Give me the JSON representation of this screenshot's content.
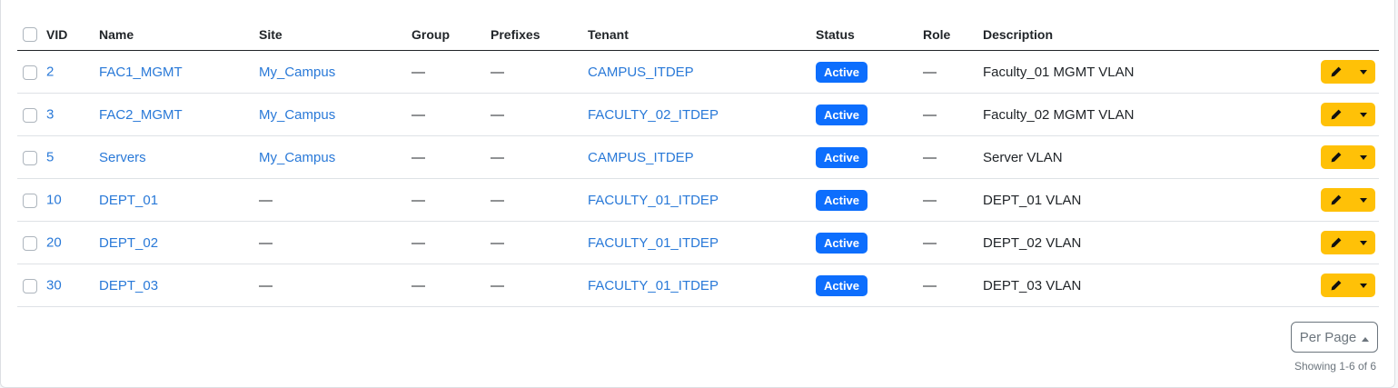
{
  "table": {
    "columns": {
      "vid": "VID",
      "name": "Name",
      "site": "Site",
      "group": "Group",
      "prefixes": "Prefixes",
      "tenant": "Tenant",
      "status": "Status",
      "role": "Role",
      "description": "Description"
    },
    "rows": [
      {
        "vid": "2",
        "name": "FAC1_MGMT",
        "site": "My_Campus",
        "group": "—",
        "prefixes": "—",
        "tenant": "CAMPUS_ITDEP",
        "status": "Active",
        "role": "—",
        "description": "Faculty_01 MGMT VLAN"
      },
      {
        "vid": "3",
        "name": "FAC2_MGMT",
        "site": "My_Campus",
        "group": "—",
        "prefixes": "—",
        "tenant": "FACULTY_02_ITDEP",
        "status": "Active",
        "role": "—",
        "description": "Faculty_02 MGMT VLAN"
      },
      {
        "vid": "5",
        "name": "Servers",
        "site": "My_Campus",
        "group": "—",
        "prefixes": "—",
        "tenant": "CAMPUS_ITDEP",
        "status": "Active",
        "role": "—",
        "description": "Server VLAN"
      },
      {
        "vid": "10",
        "name": "DEPT_01",
        "site": "—",
        "group": "—",
        "prefixes": "—",
        "tenant": "FACULTY_01_ITDEP",
        "status": "Active",
        "role": "—",
        "description": "DEPT_01 VLAN"
      },
      {
        "vid": "20",
        "name": "DEPT_02",
        "site": "—",
        "group": "—",
        "prefixes": "—",
        "tenant": "FACULTY_01_ITDEP",
        "status": "Active",
        "role": "—",
        "description": "DEPT_02 VLAN"
      },
      {
        "vid": "30",
        "name": "DEPT_03",
        "site": "—",
        "group": "—",
        "prefixes": "—",
        "tenant": "FACULTY_01_ITDEP",
        "status": "Active",
        "role": "—",
        "description": "DEPT_03 VLAN"
      }
    ]
  },
  "pagination": {
    "per_page_label": "Per Page",
    "showing": "Showing 1-6 of 6"
  },
  "colors": {
    "link": "#2979d8",
    "status_active": "#0d6efd",
    "edit_button": "#ffc107"
  },
  "icons": {
    "edit": "pencil-icon",
    "dropdown": "caret-down-icon",
    "per_page": "caret-up-icon"
  }
}
